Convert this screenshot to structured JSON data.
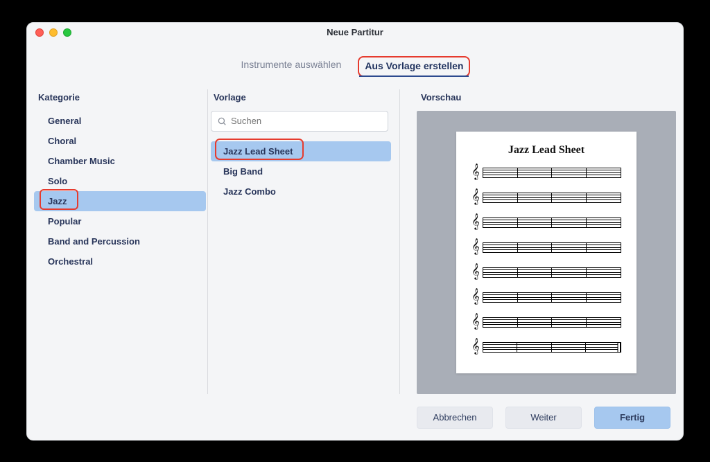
{
  "window": {
    "title": "Neue Partitur"
  },
  "tabs": {
    "instruments": "Instrumente auswählen",
    "template": "Aus Vorlage erstellen"
  },
  "labels": {
    "category": "Kategorie",
    "template": "Vorlage",
    "preview": "Vorschau"
  },
  "search": {
    "placeholder": "Suchen"
  },
  "categories": [
    "General",
    "Choral",
    "Chamber Music",
    "Solo",
    "Jazz",
    "Popular",
    "Band and Percussion",
    "Orchestral"
  ],
  "categories_selected": "Jazz",
  "templates": [
    "Jazz Lead Sheet",
    "Big Band",
    "Jazz Combo"
  ],
  "templates_selected": "Jazz Lead Sheet",
  "preview": {
    "sheet_title": "Jazz Lead Sheet"
  },
  "footer": {
    "cancel": "Abbrechen",
    "next": "Weiter",
    "done": "Fertig"
  }
}
